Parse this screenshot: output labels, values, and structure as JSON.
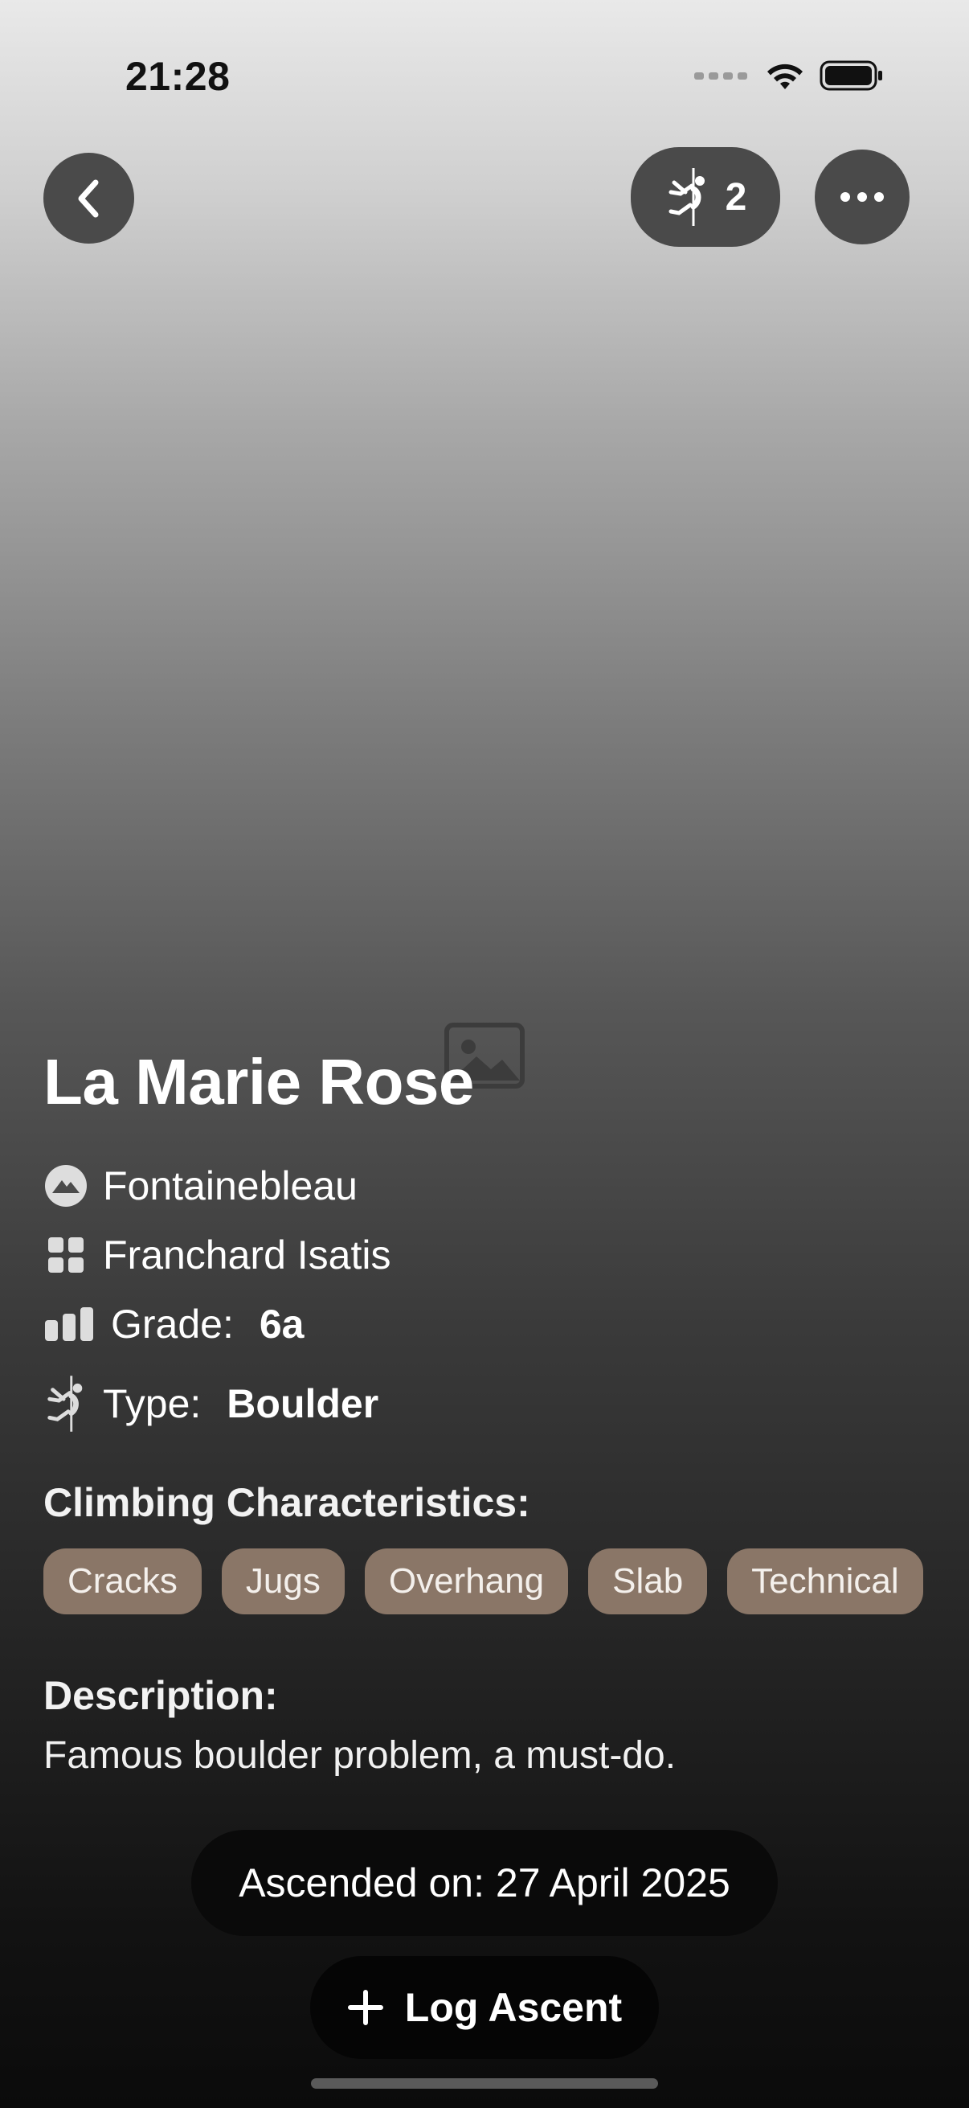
{
  "status_bar": {
    "time": "21:28",
    "icons": [
      "signal-icon",
      "wifi-icon",
      "battery-icon"
    ]
  },
  "nav": {
    "back_icon": "chevron-left-icon",
    "ascents_icon": "climber-icon",
    "ascents_count": "2",
    "more_icon": "ellipsis-icon"
  },
  "photo": {
    "icon": "photo-placeholder-icon"
  },
  "route": {
    "name": "La Marie Rose",
    "area": "Fontainebleau",
    "sector": "Franchard Isatis",
    "grade_label": "Grade:",
    "grade": "6a",
    "type_label": "Type:",
    "type": "Boulder"
  },
  "characteristics": {
    "heading": "Climbing Characteristics:",
    "tags": [
      "Cracks",
      "Jugs",
      "Overhang",
      "Slab",
      "Technical"
    ],
    "tag_color": "#8a7667"
  },
  "description": {
    "heading": "Description:",
    "text": "Famous boulder problem, a must-do."
  },
  "ascent": {
    "ascended_on": "Ascended on: 27 April 2025",
    "log_label": "Log Ascent",
    "log_icon": "plus-icon"
  }
}
